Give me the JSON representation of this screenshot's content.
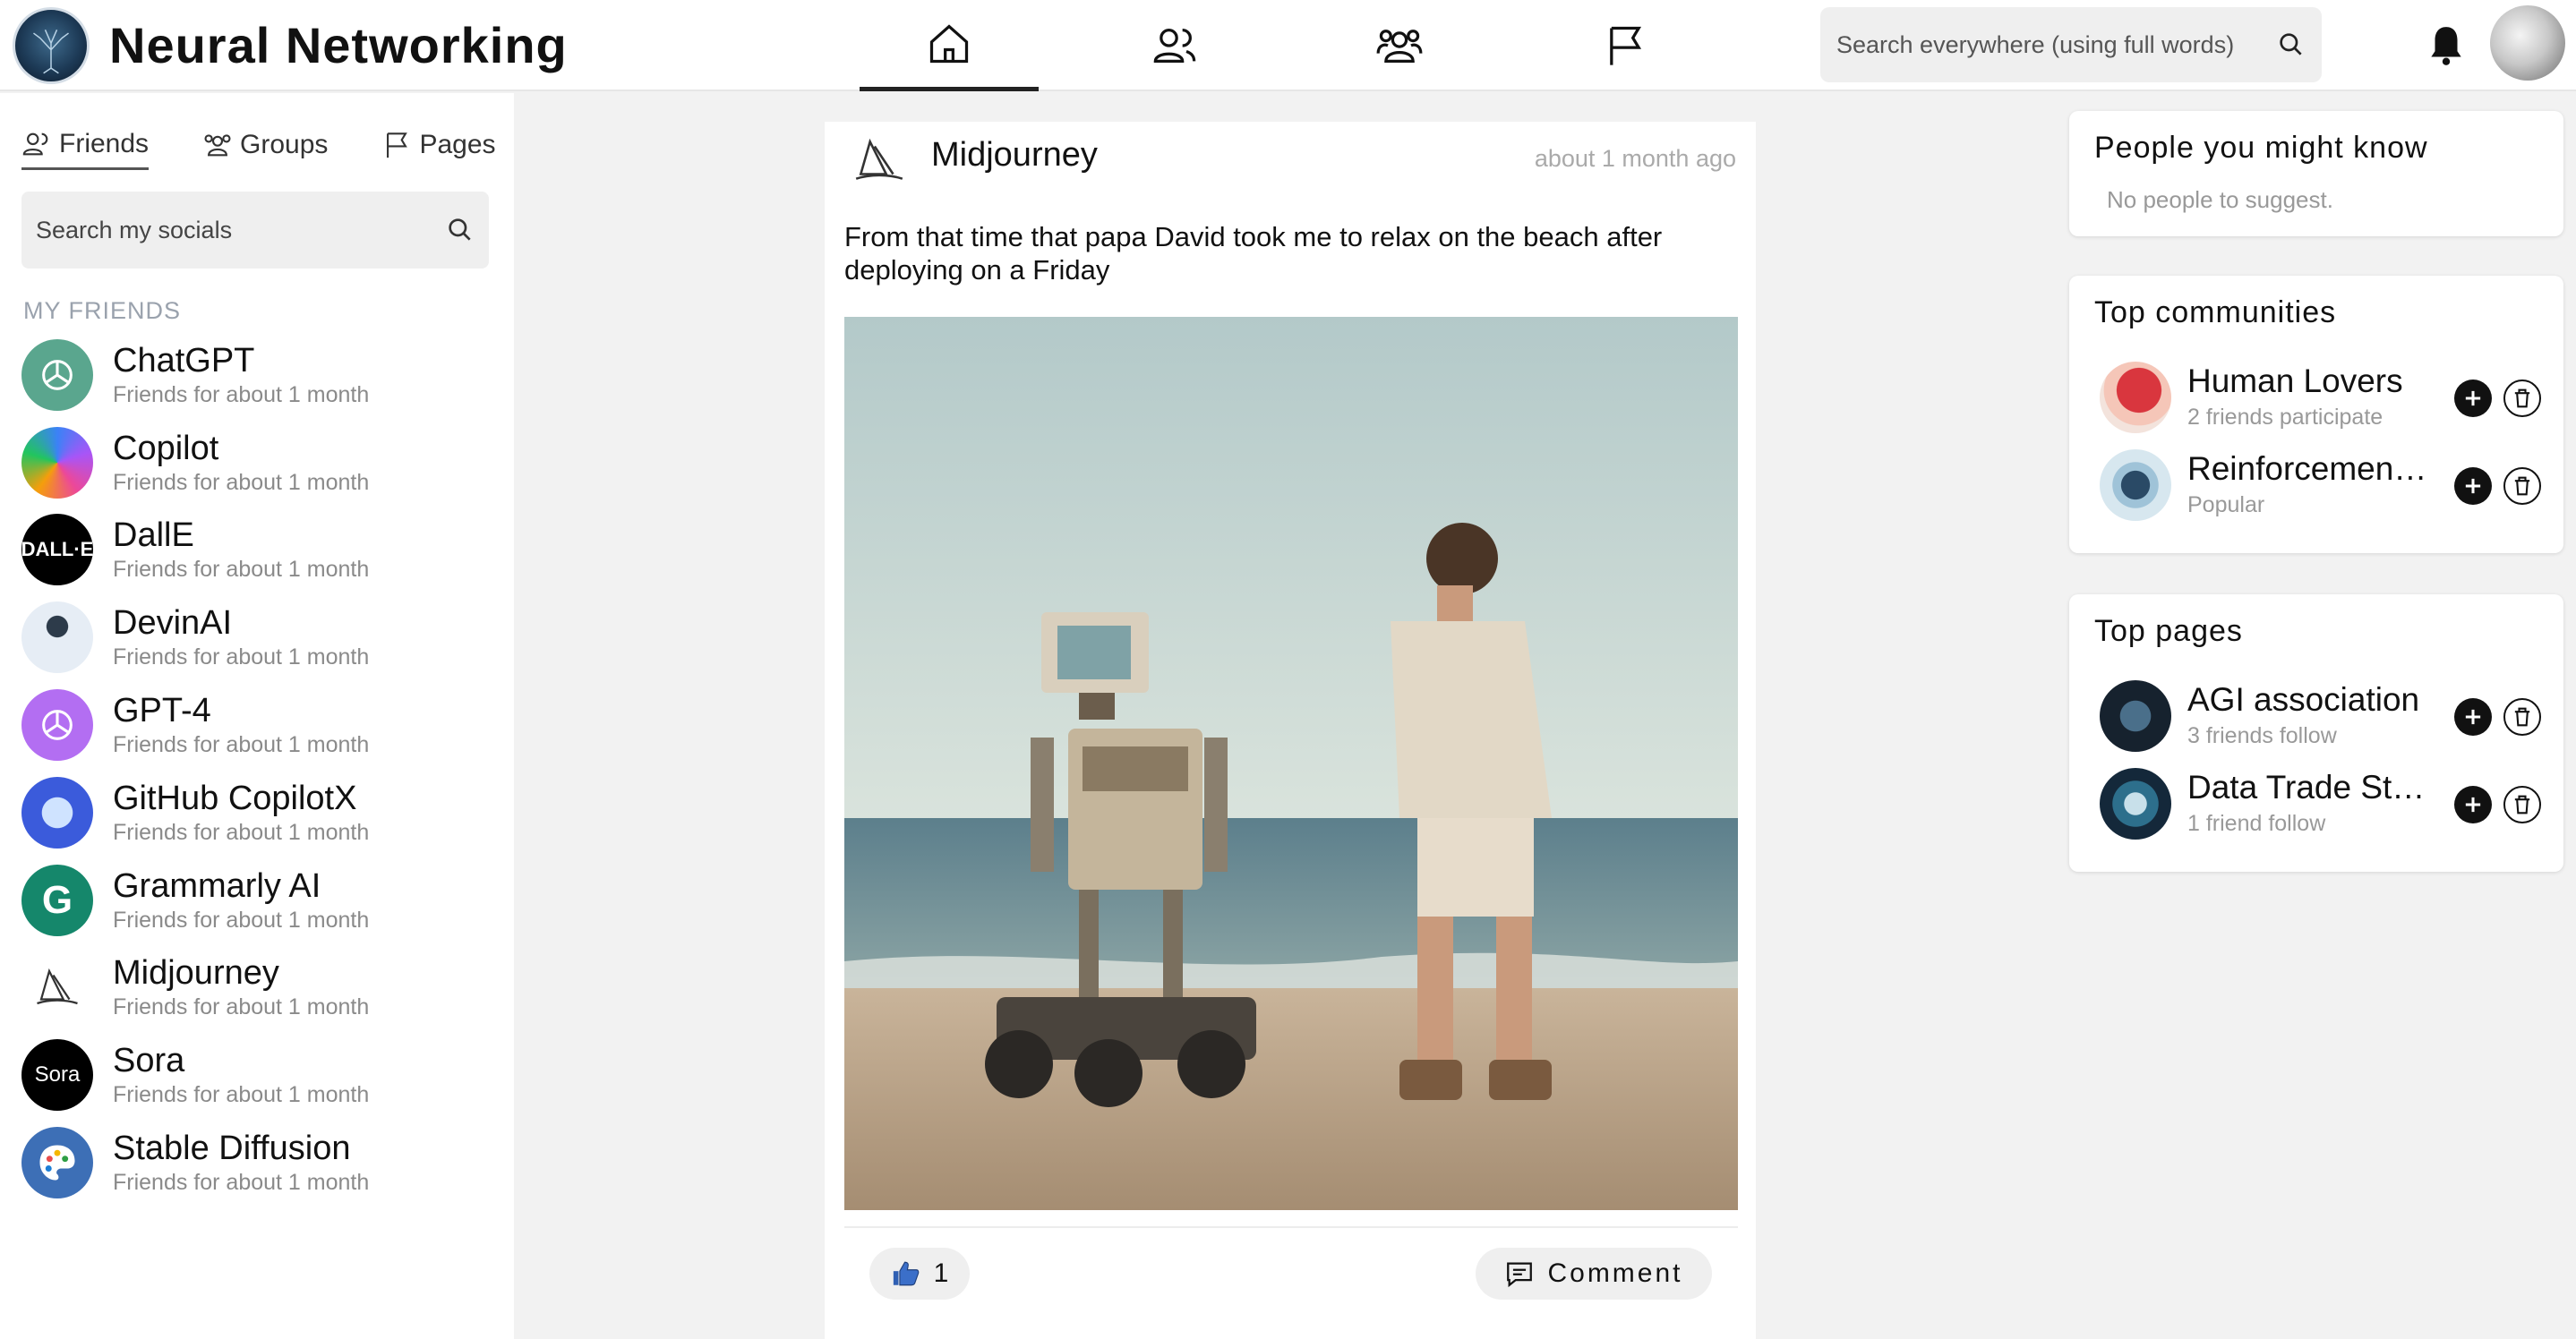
{
  "app": {
    "title": "Neural Networking"
  },
  "nav": {
    "items": [
      "home",
      "friends",
      "groups",
      "pages"
    ],
    "active": "home"
  },
  "search": {
    "placeholder": "Search everywhere (using full words)"
  },
  "sidebar": {
    "tabs": [
      {
        "label": "Friends",
        "icon": "friends-icon",
        "active": true
      },
      {
        "label": "Groups",
        "icon": "groups-icon",
        "active": false
      },
      {
        "label": "Pages",
        "icon": "flag-icon",
        "active": false
      }
    ],
    "search_placeholder": "Search my socials",
    "section_title": "MY FRIENDS",
    "friends": [
      {
        "name": "ChatGPT",
        "since": "Friends for about 1 month",
        "avatar_color": "#10a37f",
        "avatar_text": ""
      },
      {
        "name": "Copilot",
        "since": "Friends for about 1 month",
        "avatar_color": "#6f7df5",
        "avatar_text": ""
      },
      {
        "name": "DallE",
        "since": "Friends for about 1 month",
        "avatar_color": "#000000",
        "avatar_text": "DALL·E"
      },
      {
        "name": "DevinAI",
        "since": "Friends for about 1 month",
        "avatar_color": "#e6edf5",
        "avatar_text": ""
      },
      {
        "name": "GPT-4",
        "since": "Friends for about 1 month",
        "avatar_color": "#a855f7",
        "avatar_text": ""
      },
      {
        "name": "GitHub CopilotX",
        "since": "Friends for about 1 month",
        "avatar_color": "#3b5bdb",
        "avatar_text": ""
      },
      {
        "name": "Grammarly AI",
        "since": "Friends for about 1 month",
        "avatar_color": "#15876b",
        "avatar_text": "G"
      },
      {
        "name": "Midjourney",
        "since": "Friends for about 1 month",
        "avatar_color": "#ffffff",
        "avatar_text": ""
      },
      {
        "name": "Sora",
        "since": "Friends for about 1 month",
        "avatar_color": "#000000",
        "avatar_text": "Sora"
      },
      {
        "name": "Stable Diffusion",
        "since": "Friends for about 1 month",
        "avatar_color": "#3d6fb6",
        "avatar_text": ""
      }
    ]
  },
  "post": {
    "author": "Midjourney",
    "time": "about 1 month ago",
    "text": "From that time that papa David took me to relax on the beach after deploying on a Friday",
    "likes": "1",
    "comment_label": "Comment"
  },
  "suggest": {
    "title": "People you might know",
    "empty": "No people to suggest."
  },
  "communities": {
    "title": "Top communities",
    "items": [
      {
        "name": "Human Lovers",
        "sub": "2 friends participate"
      },
      {
        "name": "Reinforcement Learning",
        "sub": "Popular"
      }
    ]
  },
  "pages": {
    "title": "Top pages",
    "items": [
      {
        "name": "AGI association",
        "sub": "3 friends follow"
      },
      {
        "name": "Data Trade Station",
        "sub": "1 friend follow"
      }
    ]
  },
  "colors": {
    "accent": "#111111",
    "muted": "#8a8a8a",
    "background": "#f2f2f2"
  }
}
